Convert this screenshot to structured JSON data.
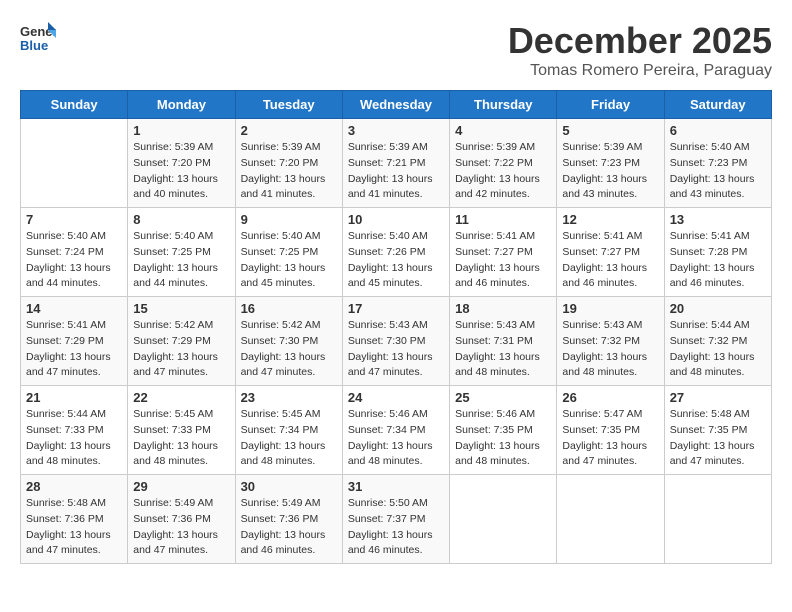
{
  "header": {
    "logo_text_general": "General",
    "logo_text_blue": "Blue",
    "month_title": "December 2025",
    "subtitle": "Tomas Romero Pereira, Paraguay"
  },
  "days_of_week": [
    "Sunday",
    "Monday",
    "Tuesday",
    "Wednesday",
    "Thursday",
    "Friday",
    "Saturday"
  ],
  "weeks": [
    [
      {
        "day": "",
        "info": ""
      },
      {
        "day": "1",
        "info": "Sunrise: 5:39 AM\nSunset: 7:20 PM\nDaylight: 13 hours\nand 40 minutes."
      },
      {
        "day": "2",
        "info": "Sunrise: 5:39 AM\nSunset: 7:20 PM\nDaylight: 13 hours\nand 41 minutes."
      },
      {
        "day": "3",
        "info": "Sunrise: 5:39 AM\nSunset: 7:21 PM\nDaylight: 13 hours\nand 41 minutes."
      },
      {
        "day": "4",
        "info": "Sunrise: 5:39 AM\nSunset: 7:22 PM\nDaylight: 13 hours\nand 42 minutes."
      },
      {
        "day": "5",
        "info": "Sunrise: 5:39 AM\nSunset: 7:23 PM\nDaylight: 13 hours\nand 43 minutes."
      },
      {
        "day": "6",
        "info": "Sunrise: 5:40 AM\nSunset: 7:23 PM\nDaylight: 13 hours\nand 43 minutes."
      }
    ],
    [
      {
        "day": "7",
        "info": "Sunrise: 5:40 AM\nSunset: 7:24 PM\nDaylight: 13 hours\nand 44 minutes."
      },
      {
        "day": "8",
        "info": "Sunrise: 5:40 AM\nSunset: 7:25 PM\nDaylight: 13 hours\nand 44 minutes."
      },
      {
        "day": "9",
        "info": "Sunrise: 5:40 AM\nSunset: 7:25 PM\nDaylight: 13 hours\nand 45 minutes."
      },
      {
        "day": "10",
        "info": "Sunrise: 5:40 AM\nSunset: 7:26 PM\nDaylight: 13 hours\nand 45 minutes."
      },
      {
        "day": "11",
        "info": "Sunrise: 5:41 AM\nSunset: 7:27 PM\nDaylight: 13 hours\nand 46 minutes."
      },
      {
        "day": "12",
        "info": "Sunrise: 5:41 AM\nSunset: 7:27 PM\nDaylight: 13 hours\nand 46 minutes."
      },
      {
        "day": "13",
        "info": "Sunrise: 5:41 AM\nSunset: 7:28 PM\nDaylight: 13 hours\nand 46 minutes."
      }
    ],
    [
      {
        "day": "14",
        "info": "Sunrise: 5:41 AM\nSunset: 7:29 PM\nDaylight: 13 hours\nand 47 minutes."
      },
      {
        "day": "15",
        "info": "Sunrise: 5:42 AM\nSunset: 7:29 PM\nDaylight: 13 hours\nand 47 minutes."
      },
      {
        "day": "16",
        "info": "Sunrise: 5:42 AM\nSunset: 7:30 PM\nDaylight: 13 hours\nand 47 minutes."
      },
      {
        "day": "17",
        "info": "Sunrise: 5:43 AM\nSunset: 7:30 PM\nDaylight: 13 hours\nand 47 minutes."
      },
      {
        "day": "18",
        "info": "Sunrise: 5:43 AM\nSunset: 7:31 PM\nDaylight: 13 hours\nand 48 minutes."
      },
      {
        "day": "19",
        "info": "Sunrise: 5:43 AM\nSunset: 7:32 PM\nDaylight: 13 hours\nand 48 minutes."
      },
      {
        "day": "20",
        "info": "Sunrise: 5:44 AM\nSunset: 7:32 PM\nDaylight: 13 hours\nand 48 minutes."
      }
    ],
    [
      {
        "day": "21",
        "info": "Sunrise: 5:44 AM\nSunset: 7:33 PM\nDaylight: 13 hours\nand 48 minutes."
      },
      {
        "day": "22",
        "info": "Sunrise: 5:45 AM\nSunset: 7:33 PM\nDaylight: 13 hours\nand 48 minutes."
      },
      {
        "day": "23",
        "info": "Sunrise: 5:45 AM\nSunset: 7:34 PM\nDaylight: 13 hours\nand 48 minutes."
      },
      {
        "day": "24",
        "info": "Sunrise: 5:46 AM\nSunset: 7:34 PM\nDaylight: 13 hours\nand 48 minutes."
      },
      {
        "day": "25",
        "info": "Sunrise: 5:46 AM\nSunset: 7:35 PM\nDaylight: 13 hours\nand 48 minutes."
      },
      {
        "day": "26",
        "info": "Sunrise: 5:47 AM\nSunset: 7:35 PM\nDaylight: 13 hours\nand 47 minutes."
      },
      {
        "day": "27",
        "info": "Sunrise: 5:48 AM\nSunset: 7:35 PM\nDaylight: 13 hours\nand 47 minutes."
      }
    ],
    [
      {
        "day": "28",
        "info": "Sunrise: 5:48 AM\nSunset: 7:36 PM\nDaylight: 13 hours\nand 47 minutes."
      },
      {
        "day": "29",
        "info": "Sunrise: 5:49 AM\nSunset: 7:36 PM\nDaylight: 13 hours\nand 47 minutes."
      },
      {
        "day": "30",
        "info": "Sunrise: 5:49 AM\nSunset: 7:36 PM\nDaylight: 13 hours\nand 46 minutes."
      },
      {
        "day": "31",
        "info": "Sunrise: 5:50 AM\nSunset: 7:37 PM\nDaylight: 13 hours\nand 46 minutes."
      },
      {
        "day": "",
        "info": ""
      },
      {
        "day": "",
        "info": ""
      },
      {
        "day": "",
        "info": ""
      }
    ]
  ]
}
